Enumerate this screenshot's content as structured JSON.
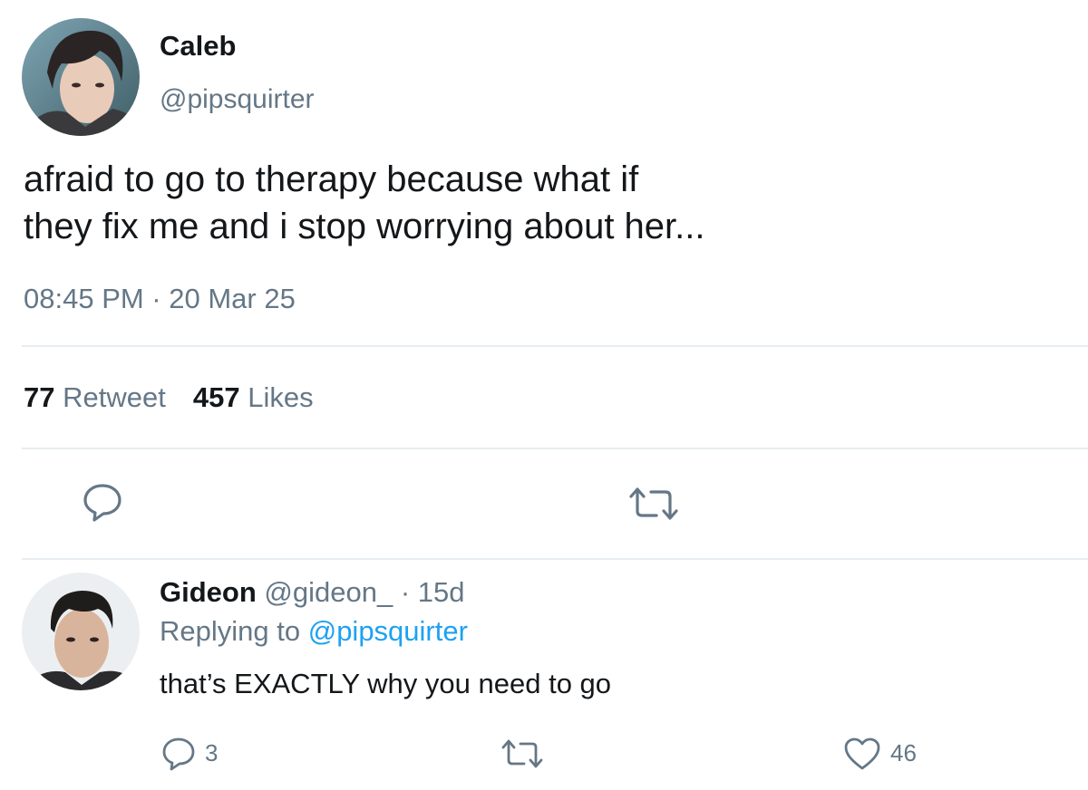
{
  "tweet": {
    "author_name": "Caleb",
    "author_handle": "@pipsquirter",
    "text_line1": "afraid to go to therapy because what if",
    "text_line2": "they fix me and i stop worrying about her...",
    "timestamp": "08:45 PM · 20 Mar 25",
    "stats": {
      "retweets_count": "77",
      "retweets_label": "Retweet",
      "likes_count": "457",
      "likes_label": "Likes"
    },
    "actions": [
      "reply-icon",
      "retweet-icon"
    ]
  },
  "reply": {
    "author_name": "Gideon",
    "author_handle": "@gideon_",
    "separator": " · ",
    "age": "15d",
    "replying_prefix": "Replying to ",
    "replying_to": "@pipsquirter",
    "text": "that’s EXACTLY why you need to go",
    "actions": {
      "reply_count": "3",
      "like_count": "46"
    }
  },
  "colors": {
    "text_primary": "#14171a",
    "text_secondary": "#657786",
    "link": "#1da1f2",
    "divider": "#e6ecf0"
  }
}
